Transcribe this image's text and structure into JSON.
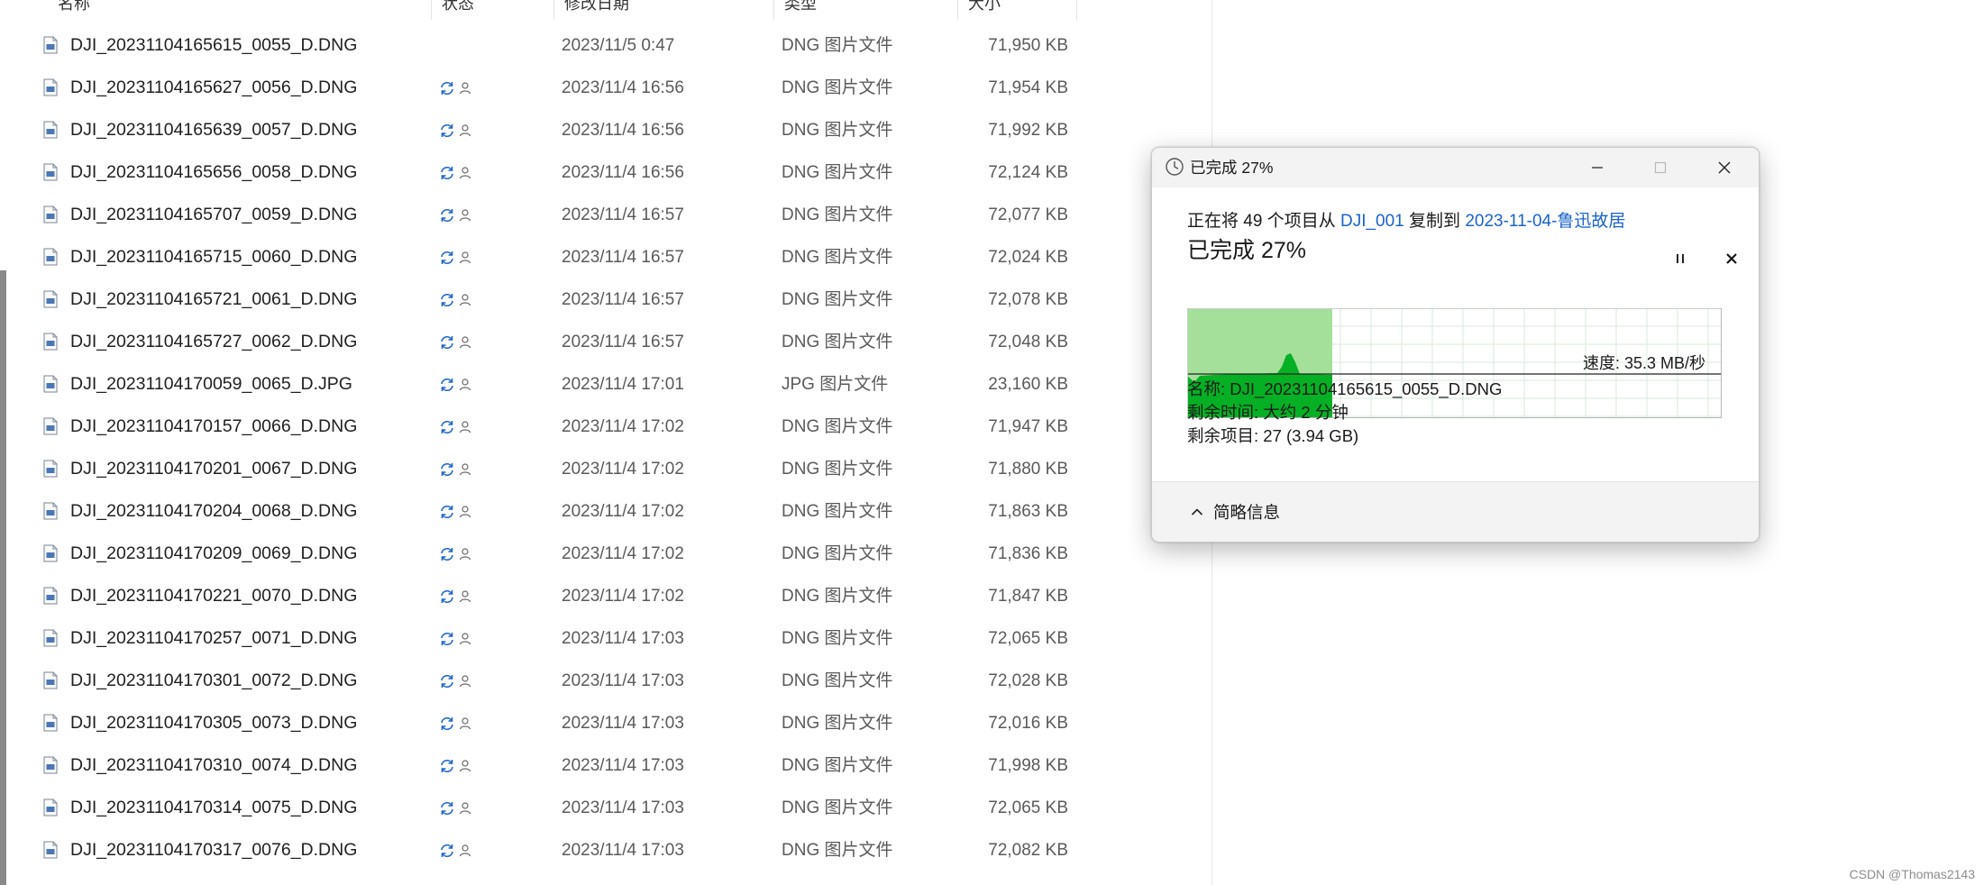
{
  "columns": {
    "name": "名称",
    "status": "状态",
    "date": "修改日期",
    "type": "类型",
    "size": "大小"
  },
  "files": [
    {
      "name": "DJI_20231104165615_0055_D.DNG",
      "status": "",
      "date": "2023/11/5 0:47",
      "type": "DNG 图片文件",
      "size": "71,950 KB",
      "icon": "dng-file-icon"
    },
    {
      "name": "DJI_20231104165627_0056_D.DNG",
      "status": "sync-pending",
      "date": "2023/11/4 16:56",
      "type": "DNG 图片文件",
      "size": "71,954 KB",
      "icon": "dng-file-icon"
    },
    {
      "name": "DJI_20231104165639_0057_D.DNG",
      "status": "sync-pending",
      "date": "2023/11/4 16:56",
      "type": "DNG 图片文件",
      "size": "71,992 KB",
      "icon": "dng-file-icon"
    },
    {
      "name": "DJI_20231104165656_0058_D.DNG",
      "status": "sync-pending",
      "date": "2023/11/4 16:56",
      "type": "DNG 图片文件",
      "size": "72,124 KB",
      "icon": "dng-file-icon"
    },
    {
      "name": "DJI_20231104165707_0059_D.DNG",
      "status": "sync-pending",
      "date": "2023/11/4 16:57",
      "type": "DNG 图片文件",
      "size": "72,077 KB",
      "icon": "dng-file-icon"
    },
    {
      "name": "DJI_20231104165715_0060_D.DNG",
      "status": "sync-pending",
      "date": "2023/11/4 16:57",
      "type": "DNG 图片文件",
      "size": "72,024 KB",
      "icon": "dng-file-icon"
    },
    {
      "name": "DJI_20231104165721_0061_D.DNG",
      "status": "sync-pending",
      "date": "2023/11/4 16:57",
      "type": "DNG 图片文件",
      "size": "72,078 KB",
      "icon": "dng-file-icon"
    },
    {
      "name": "DJI_20231104165727_0062_D.DNG",
      "status": "sync-pending",
      "date": "2023/11/4 16:57",
      "type": "DNG 图片文件",
      "size": "72,048 KB",
      "icon": "dng-file-icon"
    },
    {
      "name": "DJI_20231104170059_0065_D.JPG",
      "status": "sync-pending",
      "date": "2023/11/4 17:01",
      "type": "JPG 图片文件",
      "size": "23,160 KB",
      "icon": "jpg-file-icon"
    },
    {
      "name": "DJI_20231104170157_0066_D.DNG",
      "status": "sync-pending",
      "date": "2023/11/4 17:02",
      "type": "DNG 图片文件",
      "size": "71,947 KB",
      "icon": "dng-file-icon"
    },
    {
      "name": "DJI_20231104170201_0067_D.DNG",
      "status": "sync-pending",
      "date": "2023/11/4 17:02",
      "type": "DNG 图片文件",
      "size": "71,880 KB",
      "icon": "dng-file-icon"
    },
    {
      "name": "DJI_20231104170204_0068_D.DNG",
      "status": "sync-pending",
      "date": "2023/11/4 17:02",
      "type": "DNG 图片文件",
      "size": "71,863 KB",
      "icon": "dng-file-icon"
    },
    {
      "name": "DJI_20231104170209_0069_D.DNG",
      "status": "sync-pending",
      "date": "2023/11/4 17:02",
      "type": "DNG 图片文件",
      "size": "71,836 KB",
      "icon": "dng-file-icon"
    },
    {
      "name": "DJI_20231104170221_0070_D.DNG",
      "status": "sync-pending",
      "date": "2023/11/4 17:02",
      "type": "DNG 图片文件",
      "size": "71,847 KB",
      "icon": "dng-file-icon"
    },
    {
      "name": "DJI_20231104170257_0071_D.DNG",
      "status": "sync-pending",
      "date": "2023/11/4 17:03",
      "type": "DNG 图片文件",
      "size": "72,065 KB",
      "icon": "dng-file-icon"
    },
    {
      "name": "DJI_20231104170301_0072_D.DNG",
      "status": "sync-pending",
      "date": "2023/11/4 17:03",
      "type": "DNG 图片文件",
      "size": "72,028 KB",
      "icon": "dng-file-icon"
    },
    {
      "name": "DJI_20231104170305_0073_D.DNG",
      "status": "sync-pending",
      "date": "2023/11/4 17:03",
      "type": "DNG 图片文件",
      "size": "72,016 KB",
      "icon": "dng-file-icon"
    },
    {
      "name": "DJI_20231104170310_0074_D.DNG",
      "status": "sync-pending",
      "date": "2023/11/4 17:03",
      "type": "DNG 图片文件",
      "size": "71,998 KB",
      "icon": "dng-file-icon"
    },
    {
      "name": "DJI_20231104170314_0075_D.DNG",
      "status": "sync-pending",
      "date": "2023/11/4 17:03",
      "type": "DNG 图片文件",
      "size": "72,065 KB",
      "icon": "dng-file-icon"
    },
    {
      "name": "DJI_20231104170317_0076_D.DNG",
      "status": "sync-pending",
      "date": "2023/11/4 17:03",
      "type": "DNG 图片文件",
      "size": "72,082 KB",
      "icon": "dng-file-icon"
    }
  ],
  "dialog": {
    "title": "已完成 27%",
    "copy_prefix": "正在将 49 个项目从 ",
    "source": "DJI_001",
    "copy_middle": " 复制到 ",
    "destination": "2023-11-04-鲁迅故居",
    "progress_heading": "已完成 27%",
    "progress_percent": 27,
    "speed": "速度: 35.3 MB/秒",
    "name_line": "名称: DJI_20231104165615_0055_D.DNG",
    "time_left": "剩余时间: 大约 2 分钟",
    "items_left": "剩余项目: 27 (3.94 GB)",
    "collapse_label": "简略信息",
    "accent_color": "#06b025",
    "fill_color": "#a4e09a",
    "link_color": "#1a63c8"
  },
  "watermark": "CSDN @Thomas2143",
  "colors": {
    "sync_icon": "#1a63c8",
    "text_secondary": "#5a5a5a"
  }
}
